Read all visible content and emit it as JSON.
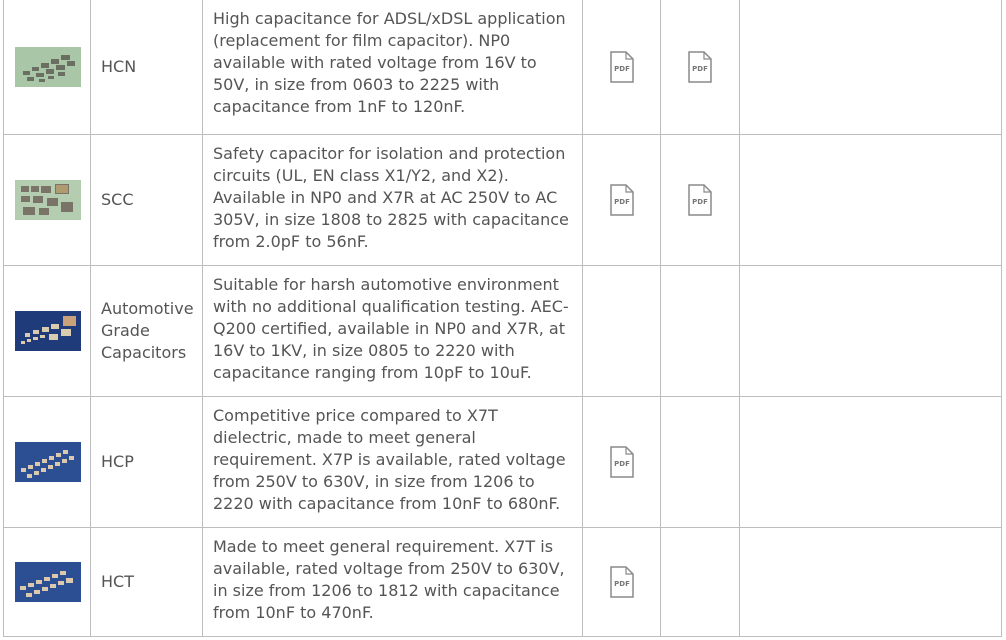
{
  "rows": [
    {
      "name": "HCN",
      "description": "High capacitance for ADSL/xDSL application (replacement for film capacitor). NP0 available with rated voltage from 16V to 50V, in size from 0603 to 2225 with capacitance from 1nF to 120nF.",
      "pdf1": "PDF",
      "pdf2": "PDF"
    },
    {
      "name": "SCC",
      "description": "Safety capacitor for isolation and protection circuits (UL, EN class X1/Y2, and X2). Available in NP0 and X7R at AC 250V to AC 305V, in size 1808 to 2825 with capacitance from 2.0pF to 56nF.",
      "pdf1": "PDF",
      "pdf2": "PDF"
    },
    {
      "name": "Automotive Grade Capacitors",
      "description": "Suitable for harsh automotive environment with no additional qualification testing. AEC-Q200 certified, available in NP0 and X7R, at 16V to 1KV, in size 0805 to 2220 with capacitance ranging from 10pF to 10uF."
    },
    {
      "name": "HCP",
      "description": "Competitive price compared to X7T dielectric, made to meet general requirement. X7P is available, rated voltage from 250V to 630V, in size from 1206 to 2220 with capacitance from 10nF to 680nF.",
      "pdf1": "PDF"
    },
    {
      "name": "HCT",
      "description": "Made to meet general requirement. X7T is available, rated voltage from 250V to 630V, in size from 1206 to 1812 with capacitance from 10nF to 470nF.",
      "pdf1": "PDF"
    }
  ],
  "icons": {
    "pdf": "pdf-document-icon"
  },
  "colors": {
    "border": "#bdbdbd",
    "text": "#555555",
    "thumb_green": "#a9c7a6",
    "thumb_blue": "#2c4f93"
  }
}
